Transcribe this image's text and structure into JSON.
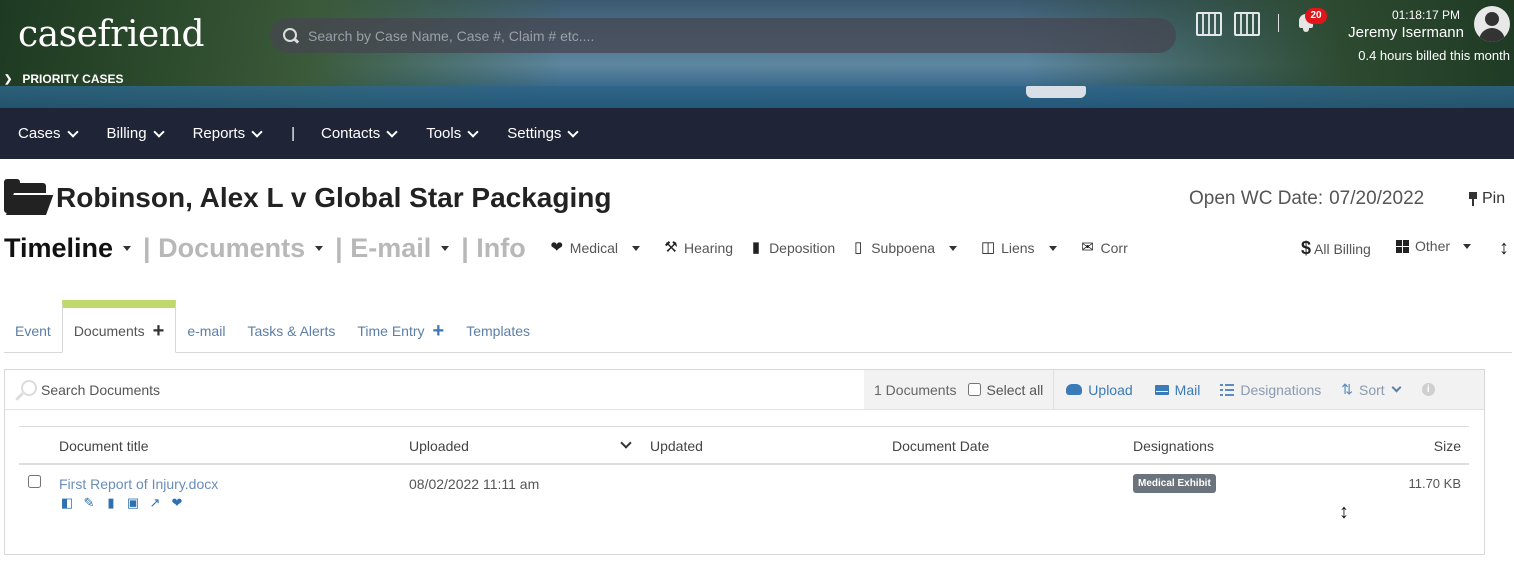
{
  "header": {
    "logo_text": "casefriend",
    "priority_cases": "PRIORITY CASES",
    "search_placeholder": "Search by Case Name, Case #, Claim # etc....",
    "notification_count": "20",
    "time": "01:18:17 PM",
    "user_name": "Jeremy Isermann",
    "billed": "0.4 hours billed this month"
  },
  "nav": {
    "items": [
      {
        "label": "Cases"
      },
      {
        "label": "Billing"
      },
      {
        "label": "Reports"
      },
      {
        "label": "Contacts"
      },
      {
        "label": "Tools"
      },
      {
        "label": "Settings"
      }
    ],
    "separator": "|"
  },
  "case": {
    "title": "Robinson, Alex L v Global Star Packaging",
    "open_date_label": "Open WC Date:",
    "open_date_value": "07/20/2022",
    "pin_label": "Pin"
  },
  "modules": {
    "timeline": "Timeline",
    "documents": "| Documents",
    "email": "| E-mail",
    "info": "| Info",
    "medical": "Medical",
    "hearing": "Hearing",
    "deposition": "Deposition",
    "subpoena": "Subpoena",
    "liens": "Liens",
    "corr": "Corr",
    "all_billing": "All Billing",
    "other": "Other"
  },
  "subtabs": {
    "event": "Event",
    "documents": "Documents",
    "email": "e-mail",
    "tasks": "Tasks & Alerts",
    "time_entry": "Time Entry",
    "templates": "Templates"
  },
  "toolbar": {
    "search_placeholder": "Search Documents",
    "count": "1 Documents",
    "select_all": "Select all",
    "upload": "Upload",
    "mail": "Mail",
    "designations": "Designations",
    "sort": "Sort",
    "info_glyph": "i"
  },
  "table": {
    "columns": [
      "Document title",
      "Uploaded",
      "Updated",
      "Document Date",
      "Designations",
      "Size"
    ],
    "rows": [
      {
        "title": "First Report of Injury.docx",
        "uploaded": "08/02/2022 11:11 am",
        "updated": "",
        "document_date": "",
        "designation": "Medical Exhibit",
        "size": "11.70 KB"
      }
    ]
  },
  "icons": {
    "search": "search-icon",
    "calendar": "calendar-icon",
    "bell": "bell-icon",
    "avatar": "user-avatar-icon",
    "folder": "folder-open-icon",
    "pin": "pin-icon"
  },
  "colors": {
    "nav_bg": "#1f2536",
    "active_tab_accent": "#c1d96b",
    "link_blue": "#3a7ab8",
    "badge_red": "#e0161b"
  }
}
